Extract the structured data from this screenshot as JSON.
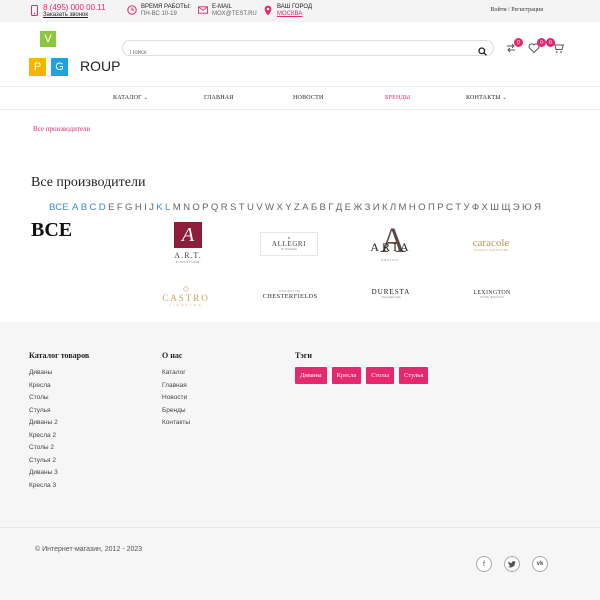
{
  "topbar": {
    "phone": "8 (495) 000 00.11",
    "callback": "Заказать звонок",
    "hours_label": "Время работы:",
    "hours_value": "ПН-ВС 10-19",
    "email_label": "E-mail",
    "email_value": "MOX@TEST.RU",
    "city_label": "Ваш город",
    "city_value": "Москва",
    "login": "Войти / Регистрация"
  },
  "logo": {
    "v": "V",
    "p": "P",
    "g": "G",
    "word": "ROUP",
    "colors": {
      "v": "#8dc63f",
      "p": "#f7b500",
      "g": "#1ea3e0"
    }
  },
  "search": {
    "placeholder": "Поиск"
  },
  "header_icons": {
    "compare_count": "0",
    "favorites_count": "0",
    "cart_count": "0"
  },
  "nav": [
    {
      "label": "Каталог",
      "chevron": true
    },
    {
      "label": "Главная",
      "chevron": false
    },
    {
      "label": "Новости",
      "chevron": false
    },
    {
      "label": "Бренды",
      "active": true
    },
    {
      "label": "Контакты",
      "chevron": true
    }
  ],
  "breadcrumb": "Все производители",
  "page_title": "Все производители",
  "alphabet": {
    "all": "ВСЕ",
    "letters": [
      "A",
      "B",
      "C",
      "D",
      "E",
      "F",
      "G",
      "H",
      "I",
      "J",
      "K",
      "L",
      "M",
      "N",
      "O",
      "P",
      "Q",
      "R",
      "S",
      "T",
      "U",
      "V",
      "W",
      "X",
      "Y",
      "Z",
      "А",
      "Б",
      "В",
      "Г",
      "Д",
      "Е",
      "Ж",
      "З",
      "И",
      "К",
      "Л",
      "М",
      "Н",
      "О",
      "П",
      "Р",
      "С",
      "Т",
      "У",
      "Ф",
      "Х",
      "Ш",
      "Щ",
      "Э",
      "Ю",
      "Я"
    ],
    "active_letters": [
      "A",
      "B",
      "C",
      "D",
      "K",
      "L"
    ]
  },
  "section_heading": "ВСЕ",
  "brands": [
    {
      "name": "A.R.T.",
      "sub": "FURNITURE",
      "mark": "A"
    },
    {
      "name": "ALLEGRI",
      "sub": "BY RUGIANO"
    },
    {
      "name": "ARIA",
      "sub": "DESIGN",
      "mark": "A"
    },
    {
      "name": "caracole",
      "sub": "CLASSIC FURNITURE"
    },
    {
      "name": "CASTRO",
      "sub": "LIGHTING"
    },
    {
      "name": "CHESTERFIELDS",
      "sub": "DISTINCTIVE"
    },
    {
      "name": "DURESTA",
      "sub": "The English Sofa"
    },
    {
      "name": "LEXINGTON",
      "sub": "HOME BRANDS"
    }
  ],
  "footer": {
    "catalog_title": "Каталог товаров",
    "catalog_links": [
      "Диваны",
      "Кресла",
      "Столы",
      "Стулья",
      "Диваны 2",
      "Кресла 2",
      "Столы 2",
      "Стулья 2",
      "Диваны 3",
      "Кресла 3"
    ],
    "about_title": "О нас",
    "about_links": [
      "Каталог",
      "Главная",
      "Новости",
      "Бренды",
      "Контакты"
    ],
    "tags_title": "Тэги",
    "tags": [
      "Диваны",
      "Кресла",
      "Столы",
      "Стулья"
    ],
    "copyright": "© Интернет-магазин, 2012 - 2023",
    "social": [
      "f",
      "t",
      "vk"
    ]
  },
  "accent": "#e5286f"
}
